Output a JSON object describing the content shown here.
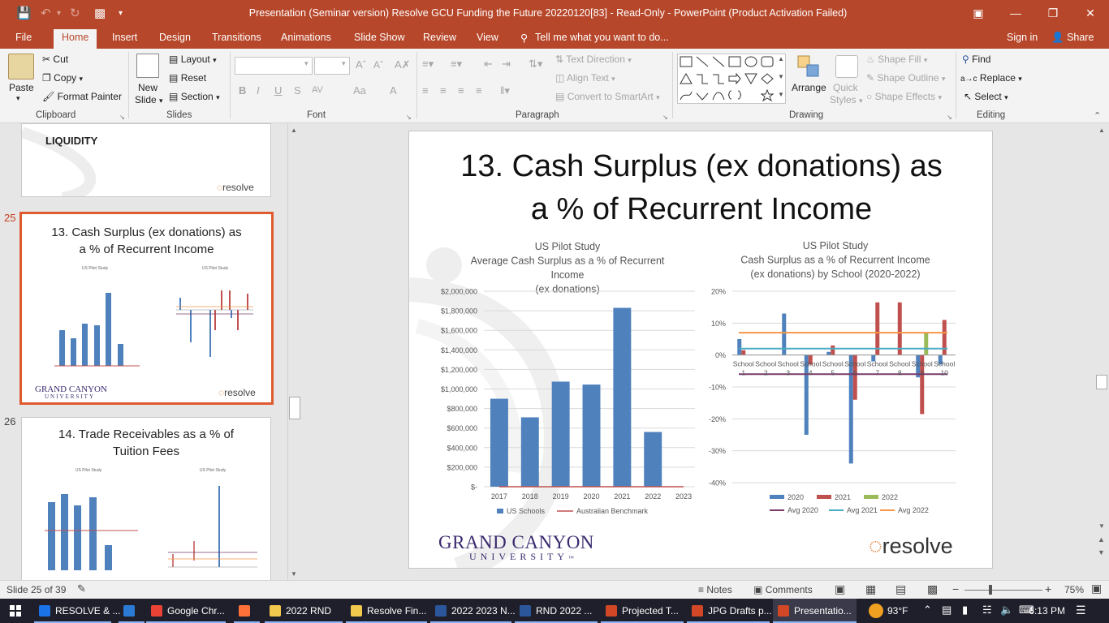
{
  "titlebar": {
    "title": "Presentation (Seminar version) Resolve GCU Funding the Future 20220120[83]  -  Read-Only - PowerPoint (Product Activation Failed)"
  },
  "tabs": {
    "file": "File",
    "home": "Home",
    "insert": "Insert",
    "design": "Design",
    "transitions": "Transitions",
    "animations": "Animations",
    "slideshow": "Slide Show",
    "review": "Review",
    "view": "View",
    "tellme": "Tell me what you want to do...",
    "signin": "Sign in",
    "share": "Share"
  },
  "ribbon": {
    "clipboard": {
      "paste": "Paste",
      "cut": "Cut",
      "copy": "Copy",
      "format_painter": "Format Painter",
      "label": "Clipboard"
    },
    "slides": {
      "new_slide_1": "New",
      "new_slide_2": "Slide",
      "layout": "Layout",
      "reset": "Reset",
      "section": "Section",
      "label": "Slides"
    },
    "font": {
      "label": "Font",
      "bold": "B",
      "italic": "I",
      "underline": "U",
      "strike": "S",
      "spacing": "AV",
      "case": "Aa",
      "color": "A"
    },
    "paragraph": {
      "label": "Paragraph",
      "text_direction": "Text Direction",
      "align_text": "Align Text",
      "smartart": "Convert to SmartArt"
    },
    "drawing": {
      "label": "Drawing",
      "arrange": "Arrange",
      "quick_styles_1": "Quick",
      "quick_styles_2": "Styles",
      "shape_fill": "Shape Fill",
      "shape_outline": "Shape Outline",
      "shape_effects": "Shape Effects"
    },
    "editing": {
      "label": "Editing",
      "find": "Find",
      "replace": "Replace",
      "select": "Select"
    }
  },
  "thumbs": {
    "t24_title": "LIQUIDITY",
    "resolve": "resolve",
    "t25_num": "25",
    "t25_title_1": "13. Cash Surplus (ex donations) as",
    "t25_title_2": "a % of Recurrent Income",
    "t25_gcu_1": "GRAND CANYON",
    "t25_gcu_2": "UNIVERSITY",
    "t26_num": "26",
    "t26_title_1": "14. Trade Receivables as a % of",
    "t26_title_2": "Tuition Fees"
  },
  "slide": {
    "title_1": "13. Cash Surplus (ex donations) as",
    "title_2": "a % of Recurrent Income",
    "gcu_1": "GRAND CANYON",
    "gcu_2": "UNIVERSITY",
    "gcu_tm": "™",
    "resolve": "resolve"
  },
  "chart_data": [
    {
      "type": "bar",
      "title": [
        "US Pilot Study",
        "Average Cash Surplus as a % of Recurrent",
        "Income",
        "(ex donations)"
      ],
      "categories": [
        "2017",
        "2018",
        "2019",
        "2020",
        "2021",
        "2022",
        "2023"
      ],
      "series": [
        {
          "name": "US Schools",
          "values": [
            900000,
            710000,
            1075000,
            1045000,
            1830000,
            560000,
            0
          ],
          "color": "#4f81bd"
        },
        {
          "name": "Australian Benchmark",
          "type": "line",
          "values": [
            0,
            0,
            0,
            0,
            0,
            0,
            0
          ],
          "color": "#c0504d"
        }
      ],
      "yticks": [
        "$2,000,000",
        "$1,800,000",
        "$1,600,000",
        "$1,400,000",
        "$1,200,000",
        "$1,000,000",
        "$800,000",
        "$600,000",
        "$400,000",
        "$200,000",
        "$-"
      ],
      "ylim": [
        0,
        2000000
      ],
      "grid": true,
      "legend": "bottom"
    },
    {
      "type": "bar",
      "title": [
        "US Pilot Study",
        "Cash Surplus as a % of Recurrent Income",
        "(ex donations) by School (2020-2022)"
      ],
      "categories_top": [
        "School",
        "School",
        "School",
        "School",
        "School",
        "School",
        "School",
        "School",
        "School",
        "School"
      ],
      "categories_num": [
        "1",
        "2",
        "3",
        "4",
        "5",
        "6",
        "7",
        "8",
        "9",
        "10"
      ],
      "series": [
        {
          "name": "2020",
          "values": [
            5,
            0,
            13,
            -25,
            1,
            -34,
            -2,
            0,
            -7,
            -3
          ],
          "color": "#4f81bd"
        },
        {
          "name": "2021",
          "values": [
            1.5,
            0,
            0,
            -3,
            3,
            -14,
            16.5,
            16.5,
            -18.5,
            11
          ],
          "color": "#c0504d"
        },
        {
          "name": "2022",
          "values": [
            0,
            0,
            0,
            0,
            0,
            0,
            0,
            0,
            7,
            0
          ],
          "color": "#9bbb59"
        }
      ],
      "averages": [
        {
          "name": "Avg 2020",
          "value": -6,
          "color": "#7a3a6a"
        },
        {
          "name": "Avg 2021",
          "value": 2,
          "color": "#4bacc6"
        },
        {
          "name": "Avg 2022",
          "value": 7,
          "color": "#f79646"
        }
      ],
      "yticks": [
        "20%",
        "10%",
        "0%",
        "-10%",
        "-20%",
        "-30%",
        "-40%"
      ],
      "ylim": [
        -40,
        20
      ],
      "grid": true,
      "legend": "bottom"
    }
  ],
  "statusbar": {
    "slide_info": "Slide 25 of 39",
    "notes": "Notes",
    "comments": "Comments",
    "zoom": "75%",
    "minus": "−",
    "plus": "+"
  },
  "taskbar": {
    "items": [
      {
        "label": "RESOLVE & ...",
        "color": "#1a73e8"
      },
      {
        "label": "",
        "color": "#2b7bd4"
      },
      {
        "label": "Google Chr...",
        "color": "#ea4335"
      },
      {
        "label": "",
        "color": "#ff7139"
      },
      {
        "label": "2022 RND",
        "color": "#f2c94c"
      },
      {
        "label": "Resolve Fin...",
        "color": "#f2c94c"
      },
      {
        "label": "2022 2023 N...",
        "color": "#2b579a"
      },
      {
        "label": "RND 2022 ...",
        "color": "#2b579a"
      },
      {
        "label": "Projected T...",
        "color": "#d24726"
      },
      {
        "label": "JPG Drafts p...",
        "color": "#d24726"
      },
      {
        "label": "Presentatio...",
        "color": "#d24726"
      }
    ],
    "weather": "93°F",
    "time": "6:13 PM"
  }
}
